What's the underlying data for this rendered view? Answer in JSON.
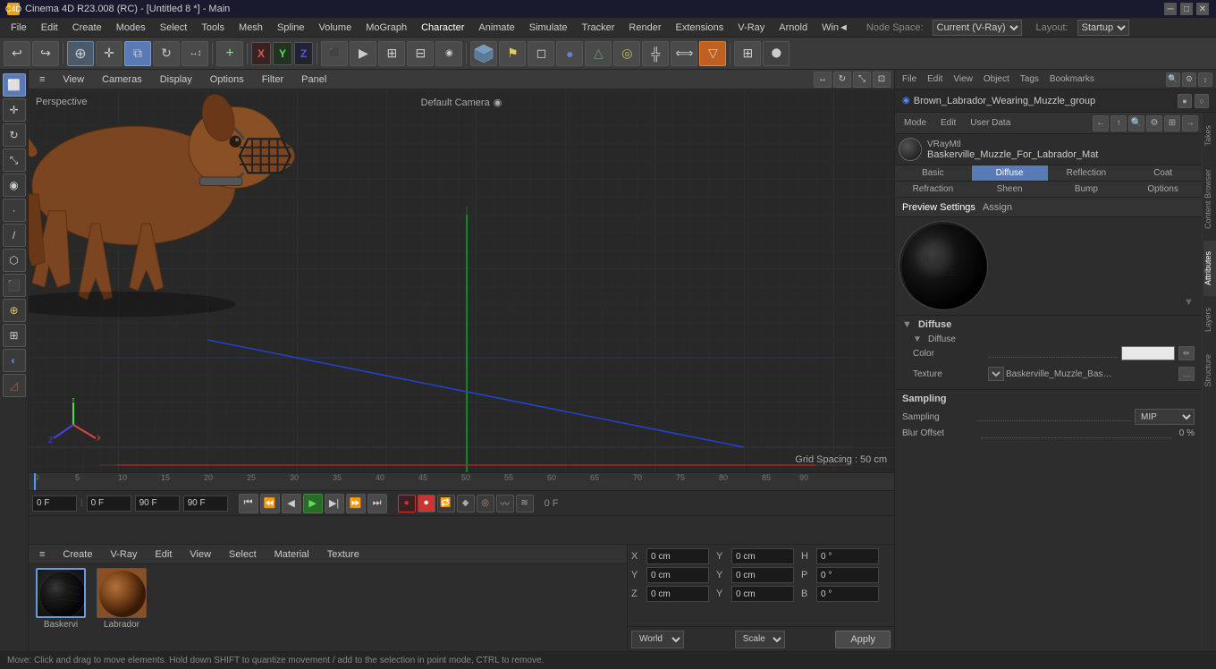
{
  "titlebar": {
    "title": "Cinema 4D R23.008 (RC) - [Untitled 8 *] - Main",
    "icon": "C4D"
  },
  "menubar": {
    "items": [
      "File",
      "Edit",
      "Create",
      "Modes",
      "Select",
      "Tools",
      "Mesh",
      "Spline",
      "Volume",
      "MoGraph",
      "Character",
      "Animate",
      "Simulate",
      "Tracker",
      "Render",
      "Extensions",
      "V-Ray",
      "Arnold",
      "Win◄",
      "Node Space:",
      "Current (V-Ray)",
      "Layout:",
      "Startup"
    ]
  },
  "toolbar": {
    "undo": "↩",
    "redo": "↪",
    "axes": {
      "x": "X",
      "y": "Y",
      "z": "Z"
    }
  },
  "viewport": {
    "label": "Perspective",
    "camera": "Default Camera",
    "camera_icon": "◉",
    "grid_spacing": "Grid Spacing : 50 cm",
    "toolbar_items": [
      "≡",
      "View",
      "Cameras",
      "Display",
      "Options",
      "Filter",
      "Panel"
    ]
  },
  "timeline": {
    "frame_current": "0 F",
    "frame_start": "0 F",
    "frame_end": "90 F",
    "fps": "90 F",
    "fps_display": "0 F",
    "ruler_marks": [
      "0",
      "5",
      "10",
      "15",
      "20",
      "25",
      "30",
      "35",
      "40",
      "45",
      "50",
      "55",
      "60",
      "65",
      "70",
      "75",
      "80",
      "85",
      "90"
    ]
  },
  "material_panel": {
    "toolbar": [
      "≡",
      "Create",
      "V-Ray",
      "Edit",
      "View",
      "Select",
      "Material",
      "Texture"
    ],
    "items": [
      {
        "label": "Baskervi",
        "type": "vrmat"
      },
      {
        "label": "Labrador",
        "type": "texture"
      }
    ]
  },
  "coords": {
    "position": {
      "x": "0 cm",
      "y": "0 cm",
      "z": "0 cm"
    },
    "rotation": {
      "h": "0 °",
      "p": "0 °",
      "b": "0 °"
    },
    "scale": {
      "x": "0 cm",
      "y": "0 cm",
      "z": "0 cm"
    },
    "world": "World",
    "scale_mode": "Scale",
    "apply": "Apply"
  },
  "right_panel": {
    "object_name": "Brown_Labrador_Wearing_Muzzle_group",
    "tabs": [
      "Takes",
      "Content Browser",
      "Attributes",
      "Layers",
      "Structure"
    ],
    "attr_toolbar": {
      "mode": "Mode",
      "edit": "Edit",
      "user_data": "User Data"
    },
    "material": {
      "type": "VRayMtl",
      "name": "Baskerville_Muzzle_For_Labrador_Mat"
    },
    "mat_tabs": [
      "Basic",
      "Diffuse",
      "Reflection",
      "Coat",
      "Refraction",
      "Sheen",
      "Bump",
      "Options"
    ],
    "preview_tabs": [
      "Preview Settings",
      "Assign"
    ],
    "diffuse": {
      "header": "Diffuse",
      "color_label": "Color",
      "color_value": "#e8e8e8",
      "texture_label": "Texture",
      "texture_value": "Baskerville_Muzzle_BaseColo",
      "texture_btn": "▼"
    },
    "sampling": {
      "header": "Sampling",
      "mip_label": "MIP",
      "blur_label": "Blur Offset",
      "blur_value": "0 %"
    }
  },
  "statusbar": {
    "text": "Move: Click and drag to move elements. Hold down SHIFT to quantize movement / add to the selection in point mode, CTRL to remove."
  }
}
